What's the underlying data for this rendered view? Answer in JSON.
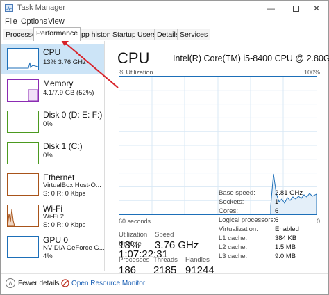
{
  "window": {
    "title": "Task Manager"
  },
  "menu": [
    "File",
    "Options",
    "View"
  ],
  "tabs": [
    "Processes",
    "Performance",
    "App history",
    "Startup",
    "Users",
    "Details",
    "Services"
  ],
  "active_tab": "Performance",
  "sidebar": {
    "items": [
      {
        "name": "CPU",
        "detail": "13%  3.76 GHz",
        "color": "#1d6fb8",
        "icon": "cpu-graph-icon"
      },
      {
        "name": "Memory",
        "detail": "4.1/7.9 GB (52%)",
        "color": "#8b2bb3",
        "icon": "memory-graph-icon"
      },
      {
        "name": "Disk 0 (D: E: F:)",
        "detail": "0%",
        "color": "#4c9a1f",
        "icon": "disk-graph-icon"
      },
      {
        "name": "Disk 1 (C:)",
        "detail": "0%",
        "color": "#4c9a1f",
        "icon": "disk-graph-icon"
      },
      {
        "name": "Ethernet",
        "detail": "VirtualBox Host-O...",
        "detail2": "S: 0  R: 0 Kbps",
        "color": "#a8541a",
        "icon": "ethernet-graph-icon"
      },
      {
        "name": "Wi-Fi",
        "detail": "Wi-Fi 2",
        "detail2": "S: 0  R: 0 Kbps",
        "color": "#a8541a",
        "icon": "wifi-graph-icon"
      },
      {
        "name": "GPU 0",
        "detail": "NVIDIA GeForce G...",
        "detail2": "4%",
        "color": "#1d6fb8",
        "icon": "gpu-graph-icon"
      }
    ]
  },
  "main": {
    "title": "CPU",
    "model": "Intel(R) Core(TM) i5-8400 CPU @ 2.80GHz",
    "util_label": "% Utilization",
    "util_max": "100%",
    "seconds_label": "60 seconds",
    "zero_label": "0",
    "utilization_label": "Utilization",
    "utilization": "13%",
    "speed_label": "Speed",
    "speed": "3.76 GHz",
    "processes_label": "Processes",
    "processes": "186",
    "threads_label": "Threads",
    "threads": "2185",
    "handles_label": "Handles",
    "handles": "91244",
    "uptime_label": "Up time",
    "uptime": "1:07:22:31",
    "specs": [
      {
        "label": "Base speed:",
        "value": "2.81 GHz"
      },
      {
        "label": "Sockets:",
        "value": "1"
      },
      {
        "label": "Cores:",
        "value": "6"
      },
      {
        "label": "Logical processors:",
        "value": "6"
      },
      {
        "label": "Virtualization:",
        "value": "Enabled"
      },
      {
        "label": "L1 cache:",
        "value": "384 KB"
      },
      {
        "label": "L2 cache:",
        "value": "1.5 MB"
      },
      {
        "label": "L3 cache:",
        "value": "9.0 MB"
      }
    ]
  },
  "footer": {
    "fewer_details": "Fewer details",
    "open_monitor": "Open Resource Monitor"
  },
  "colors": {
    "accent": "#1d6fb8",
    "selected_bg": "#cce4f7",
    "annotation_arrow": "#d8232a"
  }
}
